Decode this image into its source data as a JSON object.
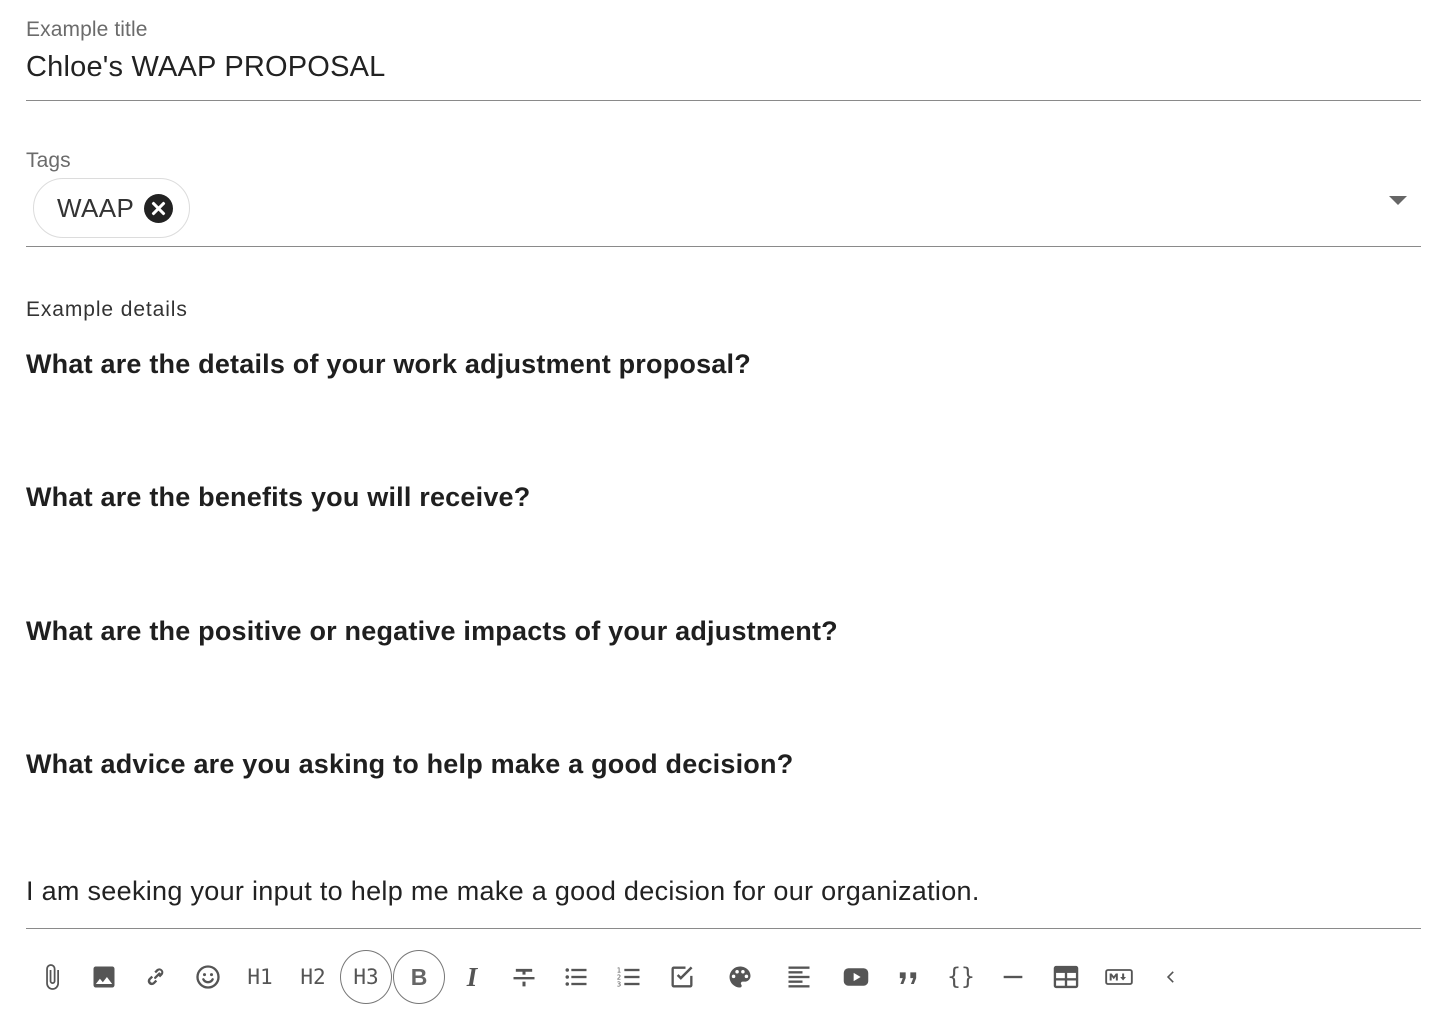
{
  "title_field": {
    "label": "Example title",
    "value": "Chloe's WAAP PROPOSAL"
  },
  "tags_field": {
    "label": "Tags",
    "chips": [
      {
        "label": "WAAP"
      }
    ]
  },
  "details": {
    "label": "Example details",
    "questions": [
      "What are the details of your work adjustment proposal?",
      "What are the benefits you will receive?",
      "What are the positive or negative impacts of your adjustment?",
      "What advice are you asking to help make a good decision?"
    ],
    "body_text": "I am seeking your input to help me make a good decision for our organization."
  },
  "toolbar": {
    "h1": "H1",
    "h2": "H2",
    "h3": "H3",
    "bold": "B",
    "italic": "I",
    "code": "{}",
    "active_items": [
      "H3",
      "B"
    ],
    "icons": [
      "attach-icon",
      "image-icon",
      "link-icon",
      "emoji-icon",
      "h1",
      "h2",
      "h3",
      "bold",
      "italic",
      "strikethrough-icon",
      "bullet-list-icon",
      "numbered-list-icon",
      "checklist-icon",
      "palette-icon",
      "align-left-icon",
      "youtube-icon",
      "quote-icon",
      "code",
      "horizontal-rule-icon",
      "table-icon",
      "markdown-icon",
      "collapse-chevron-icon"
    ]
  }
}
